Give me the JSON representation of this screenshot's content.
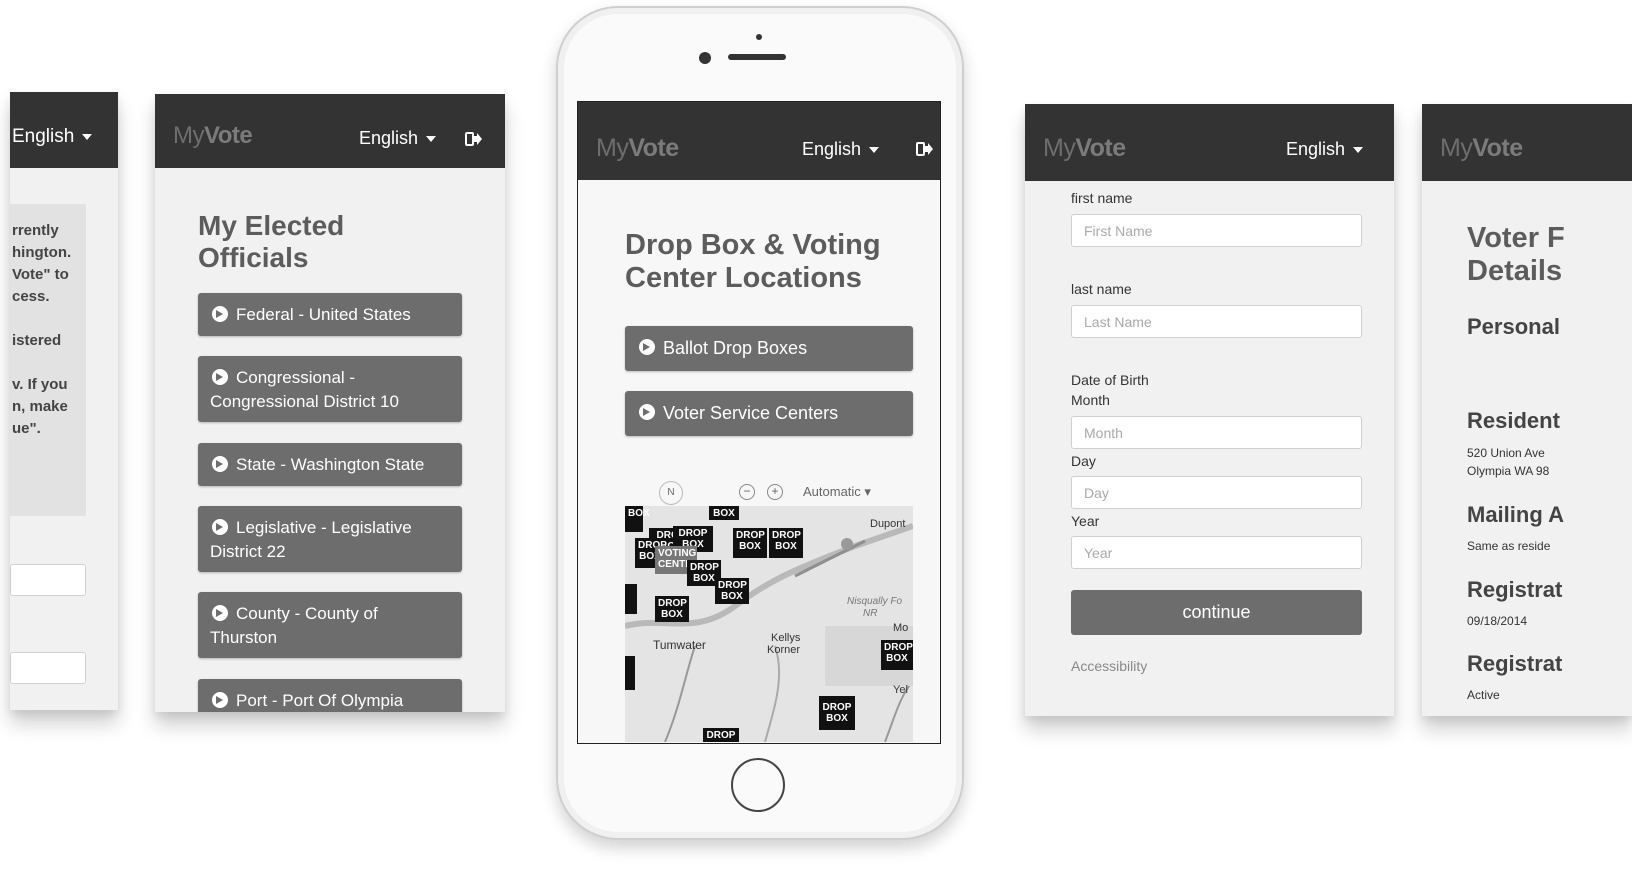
{
  "screen1": {
    "language": "English",
    "text_lines": [
      "rrently",
      "hington.",
      "Vote\" to",
      "cess.",
      "istered",
      "v. If you",
      "n, make",
      "ue\"."
    ]
  },
  "screen2": {
    "logo_my": "My",
    "logo_vote": "Vote",
    "language": "English",
    "heading_line1": "My Elected",
    "heading_line2": "Officials",
    "items": [
      {
        "line1": "Federal - United States",
        "line2": ""
      },
      {
        "line1": "Congressional -",
        "line2": "Congressional District 10"
      },
      {
        "line1": "State - Washington State",
        "line2": ""
      },
      {
        "line1": "Legislative - Legislative",
        "line2": "District 22"
      },
      {
        "line1": "County - County of",
        "line2": "Thurston"
      },
      {
        "line1": "Port - Port Of Olympia",
        "line2": ""
      }
    ]
  },
  "phone": {
    "logo_my": "My",
    "logo_vote": "Vote",
    "language": "English",
    "heading_line1": "Drop Box & Voting",
    "heading_line2": "Center Locations",
    "btn_drop_boxes": "Ballot Drop Boxes",
    "btn_voter_centers": "Voter Service Centers",
    "map": {
      "compass": "N",
      "mode": "Automatic",
      "places": {
        "dupont": "Dupont",
        "tumwater": "Tumwater",
        "kellys": "Kellys",
        "korner": "Korner",
        "nisqually": "Nisqually Fo",
        "nisqually2": "NR",
        "mo": "Mo",
        "yel": "Yel"
      },
      "pin_drop": "DROP",
      "pin_box": "BOX",
      "pin_voting": "VOTING",
      "pin_center": "CENTER"
    }
  },
  "screen4": {
    "logo_my": "My",
    "logo_vote": "Vote",
    "language": "English",
    "first_name_label": "first name",
    "first_name_placeholder": "First Name",
    "last_name_label": "last name",
    "last_name_placeholder": "Last Name",
    "dob_label": "Date of Birth",
    "month_label": "Month",
    "month_placeholder": "Month",
    "day_label": "Day",
    "day_placeholder": "Day",
    "year_label": "Year",
    "year_placeholder": "Year",
    "continue_label": "continue",
    "accessibility_link": "Accessibility"
  },
  "screen5": {
    "logo_my": "My",
    "logo_vote": "Vote",
    "heading_line1": "Voter F",
    "heading_line2": "Details",
    "personal": "Personal",
    "residence": "Resident",
    "address_line1": "520 Union Ave",
    "address_line2": "Olympia WA 98",
    "mailing": "Mailing A",
    "mailing_value": "Same as reside",
    "registration_date_h": "Registrat",
    "registration_date": "09/18/2014",
    "registration_status_h": "Registrat",
    "registration_status": "Active"
  }
}
